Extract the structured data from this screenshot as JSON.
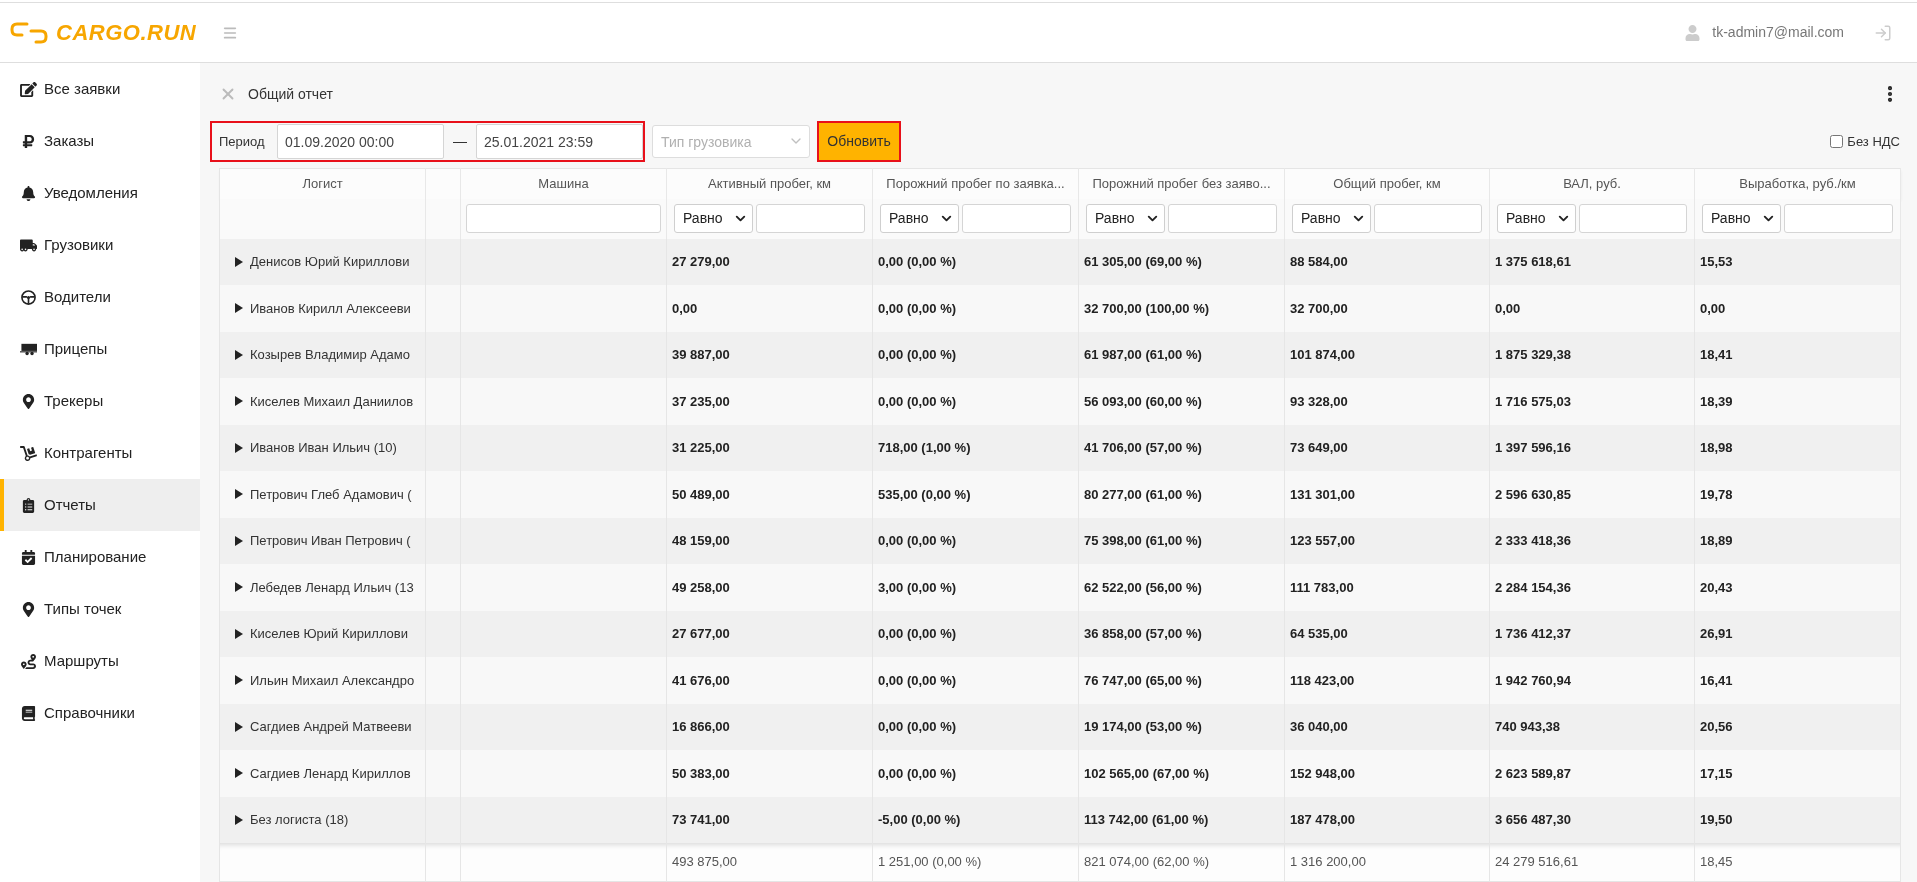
{
  "header": {
    "logo": "CARGO.RUN",
    "user_email": "tk-admin7@mail.com"
  },
  "sidebar": {
    "items": [
      {
        "label": "Все заявки",
        "selected": false
      },
      {
        "label": "Заказы",
        "selected": false
      },
      {
        "label": "Уведомления",
        "selected": false
      },
      {
        "label": "Грузовики",
        "selected": false
      },
      {
        "label": "Водители",
        "selected": false
      },
      {
        "label": "Прицепы",
        "selected": false
      },
      {
        "label": "Трекеры",
        "selected": false
      },
      {
        "label": "Контрагенты",
        "selected": false
      },
      {
        "label": "Отчеты",
        "selected": true
      },
      {
        "label": "Планирование",
        "selected": false
      },
      {
        "label": "Типы точек",
        "selected": false
      },
      {
        "label": "Маршруты",
        "selected": false
      },
      {
        "label": "Справочники",
        "selected": false
      }
    ]
  },
  "report": {
    "title": "Общий отчет"
  },
  "filters": {
    "period": {
      "label": "Период",
      "from": "01.09.2020 00:00",
      "separator": "—",
      "to": "25.01.2021 23:59",
      "highlighted": true
    },
    "truck_type": {
      "placeholder": "Тип грузовика"
    },
    "refresh_button": {
      "label": "Обновить",
      "highlighted": true
    },
    "vat": {
      "label": "Без НДС",
      "checked": false
    }
  },
  "table": {
    "columns": [
      {
        "label": "Логист",
        "kind": "plain"
      },
      {
        "kind": "plain"
      },
      {
        "label": "Машина",
        "kind": "text_filter"
      },
      {
        "label": "Активный пробег, км",
        "kind": "compare_filter",
        "operator": "Равно"
      },
      {
        "label": "Порожний пробег по заявка...",
        "kind": "compare_filter",
        "operator": "Равно"
      },
      {
        "label": "Порожний пробег без заяво...",
        "kind": "compare_filter",
        "operator": "Равно"
      },
      {
        "label": "Общий пробег, км",
        "kind": "compare_filter",
        "operator": "Равно"
      },
      {
        "label": "ВАЛ, руб.",
        "kind": "compare_filter",
        "operator": "Равно"
      },
      {
        "label": "Выработка, руб./км",
        "kind": "compare_filter",
        "operator": "Равно"
      }
    ],
    "rows": [
      {
        "logist": "Денисов Юрий Кириллови",
        "expanded": false,
        "values": [
          "27 279,00",
          "0,00 (0,00 %)",
          "61 305,00 (69,00 %)",
          "88 584,00",
          "1 375 618,61",
          "15,53"
        ]
      },
      {
        "logist": "Иванов Кирилл Алексееви",
        "expanded": false,
        "values": [
          "0,00",
          "0,00 (0,00 %)",
          "32 700,00 (100,00 %)",
          "32 700,00",
          "0,00",
          "0,00"
        ]
      },
      {
        "logist": "Козырев Владимир Адамо",
        "expanded": false,
        "values": [
          "39 887,00",
          "0,00 (0,00 %)",
          "61 987,00 (61,00 %)",
          "101 874,00",
          "1 875 329,38",
          "18,41"
        ]
      },
      {
        "logist": "Киселев Михаил Даниилов",
        "expanded": false,
        "values": [
          "37 235,00",
          "0,00 (0,00 %)",
          "56 093,00 (60,00 %)",
          "93 328,00",
          "1 716 575,03",
          "18,39"
        ]
      },
      {
        "logist": "Иванов Иван Ильич (10)",
        "expanded": false,
        "values": [
          "31 225,00",
          "718,00 (1,00 %)",
          "41 706,00 (57,00 %)",
          "73 649,00",
          "1 397 596,16",
          "18,98"
        ]
      },
      {
        "logist": "Петрович Глеб Адамович (",
        "expanded": false,
        "values": [
          "50 489,00",
          "535,00 (0,00 %)",
          "80 277,00 (61,00 %)",
          "131 301,00",
          "2 596 630,85",
          "19,78"
        ]
      },
      {
        "logist": "Петрович Иван Петрович (",
        "expanded": false,
        "values": [
          "48 159,00",
          "0,00 (0,00 %)",
          "75 398,00 (61,00 %)",
          "123 557,00",
          "2 333 418,36",
          "18,89"
        ]
      },
      {
        "logist": "Лебедев Ленард Ильич (13",
        "expanded": false,
        "values": [
          "49 258,00",
          "3,00 (0,00 %)",
          "62 522,00 (56,00 %)",
          "111 783,00",
          "2 284 154,36",
          "20,43"
        ]
      },
      {
        "logist": "Киселев Юрий Кириллови",
        "expanded": false,
        "values": [
          "27 677,00",
          "0,00 (0,00 %)",
          "36 858,00 (57,00 %)",
          "64 535,00",
          "1 736 412,37",
          "26,91"
        ]
      },
      {
        "logist": "Ильин Михаил Александро",
        "expanded": false,
        "values": [
          "41 676,00",
          "0,00 (0,00 %)",
          "76 747,00 (65,00 %)",
          "118 423,00",
          "1 942 760,94",
          "16,41"
        ]
      },
      {
        "logist": "Сагдиев Андрей Матвееви",
        "expanded": false,
        "values": [
          "16 866,00",
          "0,00 (0,00 %)",
          "19 174,00 (53,00 %)",
          "36 040,00",
          "740 943,38",
          "20,56"
        ]
      },
      {
        "logist": "Сагдиев Ленард Кириллов",
        "expanded": false,
        "values": [
          "50 383,00",
          "0,00 (0,00 %)",
          "102 565,00 (67,00 %)",
          "152 948,00",
          "2 623 589,87",
          "17,15"
        ]
      },
      {
        "logist": "Без логиста (18)",
        "expanded": false,
        "values": [
          "73 741,00",
          "-5,00 (0,00 %)",
          "113 742,00 (61,00 %)",
          "187 478,00",
          "3 656 487,30",
          "19,50"
        ]
      }
    ],
    "totals": [
      "493 875,00",
      "1 251,00 (0,00 %)",
      "821 074,00 (62,00 %)",
      "1 316 200,00",
      "24 279 516,61",
      "18,45"
    ]
  }
}
